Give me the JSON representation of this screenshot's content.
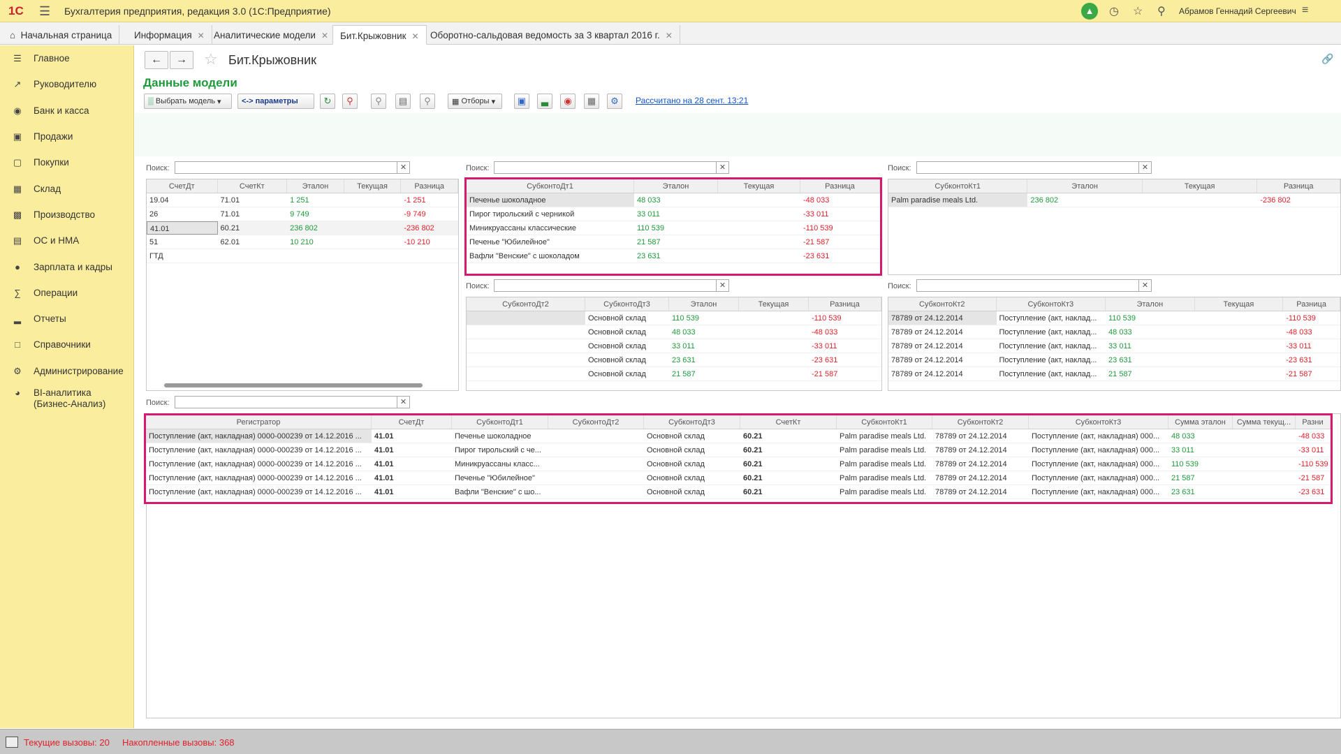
{
  "app": {
    "title": "Бухгалтерия предприятия, редакция 3.0 (1С:Предприятие)",
    "logo": "1С",
    "user": "Абрамов Геннадий Сергеевич"
  },
  "tabs": [
    "Начальная страница",
    "Информация",
    "Аналитические модели",
    "Бит.Крыжовник",
    "Оборотно-сальдовая ведомость за 3 квартал 2016 г."
  ],
  "sidebar": [
    "Главное",
    "Руководителю",
    "Банк и касса",
    "Продажи",
    "Покупки",
    "Склад",
    "Производство",
    "ОС и НМА",
    "Зарплата и кадры",
    "Операции",
    "Отчеты",
    "Справочники",
    "Администрирование",
    "BI-аналитика\n(Бизнес-Анализ)"
  ],
  "doc": {
    "title": "Бит.Крыжовник",
    "section": "Данные модели"
  },
  "toolbar": {
    "choose_model": "Выбрать модель",
    "params": "<-> параметры",
    "filters": "Отборы",
    "calc_link": "Рассчитано на 28 сент. 13:21"
  },
  "search_label": "Поиск:",
  "grid1": {
    "headers": [
      "СчетДт",
      "СчетКт",
      "Эталон",
      "Текущая",
      "Разница"
    ],
    "rows": [
      [
        "19.04",
        "71.01",
        "1 251",
        "",
        "-1 251"
      ],
      [
        "26",
        "71.01",
        "9 749",
        "",
        "-9 749"
      ],
      [
        "41.01",
        "60.21",
        "236 802",
        "",
        "-236 802"
      ],
      [
        "51",
        "62.01",
        "10 210",
        "",
        "-10 210"
      ],
      [
        "ГТД",
        "",
        "",
        "",
        ""
      ]
    ]
  },
  "grid2": {
    "headers": [
      "СубконтоДт1",
      "Эталон",
      "Текущая",
      "Разница"
    ],
    "rows": [
      [
        "Печенье шоколадное",
        "48 033",
        "",
        "-48 033"
      ],
      [
        "Пирог тирольский с черникой",
        "33 011",
        "",
        "-33 011"
      ],
      [
        "Миникруассаны классические",
        "110 539",
        "",
        "-110 539"
      ],
      [
        "Печенье \"Юбилейное\"",
        "21 587",
        "",
        "-21 587"
      ],
      [
        "Вафли \"Венские\" с шоколадом",
        "23 631",
        "",
        "-23 631"
      ]
    ]
  },
  "grid3": {
    "headers": [
      "СубконтоКт1",
      "Эталон",
      "Текущая",
      "Разница"
    ],
    "rows": [
      [
        "Palm paradise meals Ltd.",
        "236 802",
        "",
        "-236 802"
      ]
    ]
  },
  "grid4": {
    "headers": [
      "СубконтоДт2",
      "СубконтоДт3",
      "Эталон",
      "Текущая",
      "Разница"
    ],
    "rows": [
      [
        "",
        "Основной склад",
        "110 539",
        "",
        "-110 539"
      ],
      [
        "",
        "Основной склад",
        "48 033",
        "",
        "-48 033"
      ],
      [
        "",
        "Основной склад",
        "33 011",
        "",
        "-33 011"
      ],
      [
        "",
        "Основной склад",
        "23 631",
        "",
        "-23 631"
      ],
      [
        "",
        "Основной склад",
        "21 587",
        "",
        "-21 587"
      ]
    ]
  },
  "grid5": {
    "headers": [
      "СубконтоКт2",
      "СубконтоКт3",
      "Эталон",
      "Текущая",
      "Разница"
    ],
    "rows": [
      [
        "78789 от 24.12.2014",
        "Поступление (акт, наклад...",
        "110 539",
        "",
        "-110 539"
      ],
      [
        "78789 от 24.12.2014",
        "Поступление (акт, наклад...",
        "48 033",
        "",
        "-48 033"
      ],
      [
        "78789 от 24.12.2014",
        "Поступление (акт, наклад...",
        "33 011",
        "",
        "-33 011"
      ],
      [
        "78789 от 24.12.2014",
        "Поступление (акт, наклад...",
        "23 631",
        "",
        "-23 631"
      ],
      [
        "78789 от 24.12.2014",
        "Поступление (акт, наклад...",
        "21 587",
        "",
        "-21 587"
      ]
    ]
  },
  "grid6": {
    "headers": [
      "Регистратор",
      "СчетДт",
      "СубконтоДт1",
      "СубконтоДт2",
      "СубконтоДт3",
      "СчетКт",
      "СубконтоКт1",
      "СубконтоКт2",
      "СубконтоКт3",
      "Сумма эталон",
      "Сумма текущ...",
      "Разни"
    ],
    "rows": [
      [
        "Поступление (акт, накладная) 0000-000239 от 14.12.2016 ...",
        "41.01",
        "Печенье шоколадное",
        "",
        "Основной склад",
        "60.21",
        "Palm paradise meals Ltd.",
        "78789 от 24.12.2014",
        "Поступление (акт, накладная) 000...",
        "48 033",
        "",
        "-48 033"
      ],
      [
        "Поступление (акт, накладная) 0000-000239 от 14.12.2016 ...",
        "41.01",
        "Пирог тирольский с че...",
        "",
        "Основной склад",
        "60.21",
        "Palm paradise meals Ltd.",
        "78789 от 24.12.2014",
        "Поступление (акт, накладная) 000...",
        "33 011",
        "",
        "-33 011"
      ],
      [
        "Поступление (акт, накладная) 0000-000239 от 14.12.2016 ...",
        "41.01",
        "Миникруассаны класс...",
        "",
        "Основной склад",
        "60.21",
        "Palm paradise meals Ltd.",
        "78789 от 24.12.2014",
        "Поступление (акт, накладная) 000...",
        "110 539",
        "",
        "-110 539"
      ],
      [
        "Поступление (акт, накладная) 0000-000239 от 14.12.2016 ...",
        "41.01",
        "Печенье \"Юбилейное\"",
        "",
        "Основной склад",
        "60.21",
        "Palm paradise meals Ltd.",
        "78789 от 24.12.2014",
        "Поступление (акт, накладная) 000...",
        "21 587",
        "",
        "-21 587"
      ],
      [
        "Поступление (акт, накладная) 0000-000239 от 14.12.2016 ...",
        "41.01",
        "Вафли \"Венские\" с шо...",
        "",
        "Основной склад",
        "60.21",
        "Palm paradise meals Ltd.",
        "78789 от 24.12.2014",
        "Поступление (акт, накладная) 000...",
        "23 631",
        "",
        "-23 631"
      ]
    ]
  },
  "status": {
    "current": "Текущие вызовы: 20",
    "accumulated": "Накопленные вызовы: 368"
  },
  "colors": {
    "accent": "#fbed9e",
    "highlight": "#d6186e",
    "positive": "#1f9a3b",
    "negative": "#e0202a"
  }
}
